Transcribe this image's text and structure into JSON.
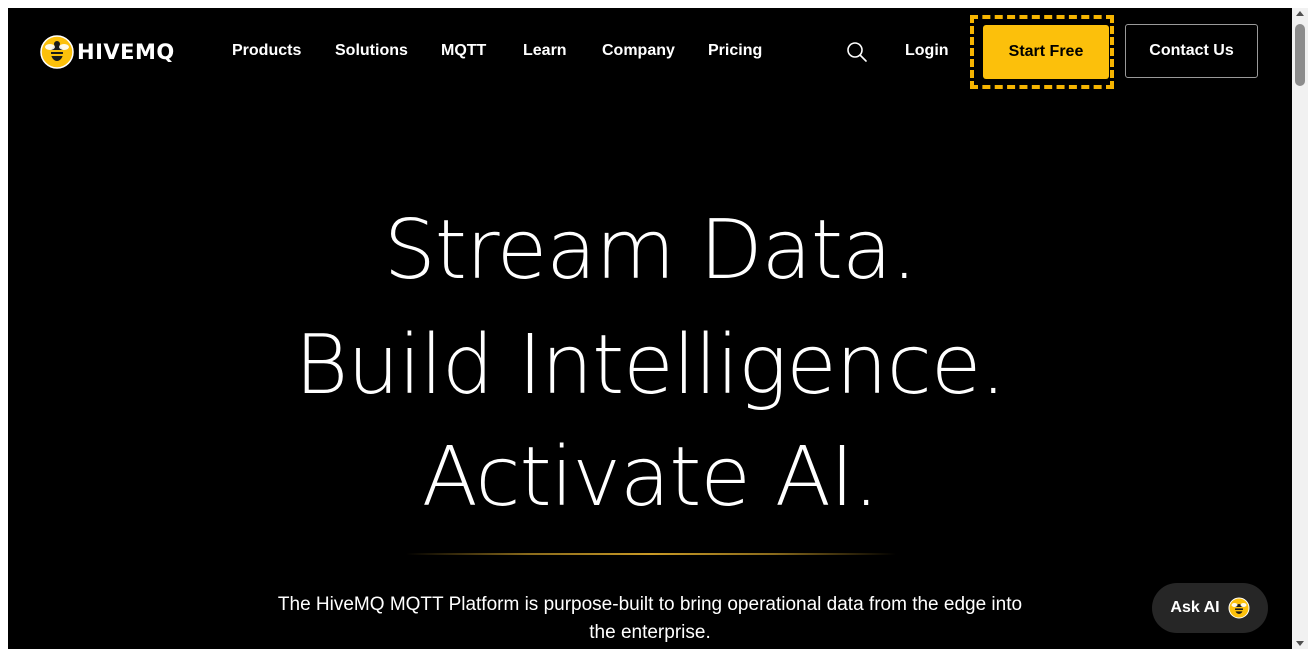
{
  "brand": {
    "name": "HIVEMQ",
    "accent_color": "#fcc00b"
  },
  "nav": {
    "items": [
      {
        "label": "Products"
      },
      {
        "label": "Solutions"
      },
      {
        "label": "MQTT"
      },
      {
        "label": "Learn"
      },
      {
        "label": "Company"
      },
      {
        "label": "Pricing"
      }
    ],
    "search_icon": "search-icon",
    "login_label": "Login",
    "start_free_label": "Start Free",
    "contact_label": "Contact Us"
  },
  "hero": {
    "line1": "Stream Data.",
    "line2": "Build Intelligence.",
    "line3": "Activate AI.",
    "subtitle_line1": "The HiveMQ MQTT Platform is purpose-built to bring operational data from the edge into",
    "subtitle_line2": "the enterprise."
  },
  "ask_ai": {
    "label": "Ask AI",
    "icon": "bee-icon"
  }
}
